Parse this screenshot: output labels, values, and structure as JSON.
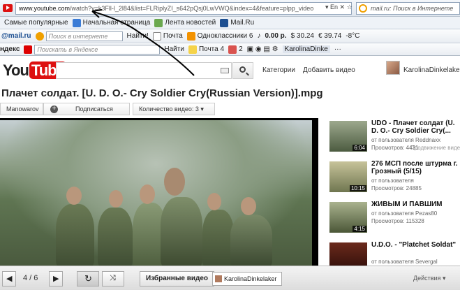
{
  "browser": {
    "address": "www.youtube.com/watch?v=k3Fll-l_2l84&list=FLRiplyZI_s642pQsj0LwVWQ&index=4&feature=plpp_video",
    "address_host": "www.youtube.com",
    "address_rest": "/watch?v=k3Fll-l_2l84&list=FLRiplyZI_s642pQsj0LwVWQ&index=4&feature=plpp_video",
    "lang_badge": "En",
    "search_placeholder": "mail.ru: Поиск в Интернете"
  },
  "favorites": {
    "items": [
      "Самые популярные",
      "Начальная страница",
      "Лента новостей",
      "Mail.Ru"
    ]
  },
  "mail_toolbar": {
    "logo": "@mail.ru",
    "search_placeholder": "Поиск в интернете",
    "find": "Найти!",
    "mail": "Почта",
    "ok": "Одноклассники",
    "ok_count": "6",
    "price": "0.00 р.",
    "usd": "$ 30.24",
    "eur": "€ 39.74",
    "temp": "-8°C"
  },
  "yandex_toolbar": {
    "label": "ндекс",
    "search_placeholder": "Поискать в Яндексе",
    "find": "Найти",
    "mail": "Почта",
    "mail_count": "4",
    "counter": "2",
    "user": "KarolinaDinke",
    "dots": "···"
  },
  "youtube": {
    "logo_you": "You",
    "logo_tube": "Tube",
    "categories": "Категории",
    "add_video": "Добавить видео",
    "username": "KarolinaDinkelaker",
    "video_title": "Плачет солдат. [U. D. O.- Cry Soldier Cry(Russian Version)].mpg",
    "channel": "Manowarov",
    "subscribe": "Подписаться",
    "video_count": "Количество видео: 3",
    "sidebar_caption": "Продвижение видео",
    "related": [
      {
        "title": "UDO - Плачет солдат (U. D. O.- Cry Soldier Cry(...",
        "by": "от пользователя Reddnaxx",
        "views": "Просмотров: 4431",
        "duration": "6:04"
      },
      {
        "title": "276 МСП после штурма г. Грозный (5/15)",
        "by": "от пользователя",
        "views": "Просмотров: 24885",
        "duration": "10:15"
      },
      {
        "title": "ЖИВЫМ И ПАВШИМ",
        "by": "от пользователя Pezas80",
        "views": "Просмотров: 115328",
        "duration": "4:15"
      },
      {
        "title": "U.D.O. - \"Platchet Soldat\"",
        "by": "от пользователя Severgal",
        "views": "",
        "duration": ""
      }
    ]
  },
  "playlist_bar": {
    "position": "4 / 6",
    "favorites_label": "Избранные видео",
    "owner": "KarolinaDinkelaker",
    "actions": "Действия"
  }
}
